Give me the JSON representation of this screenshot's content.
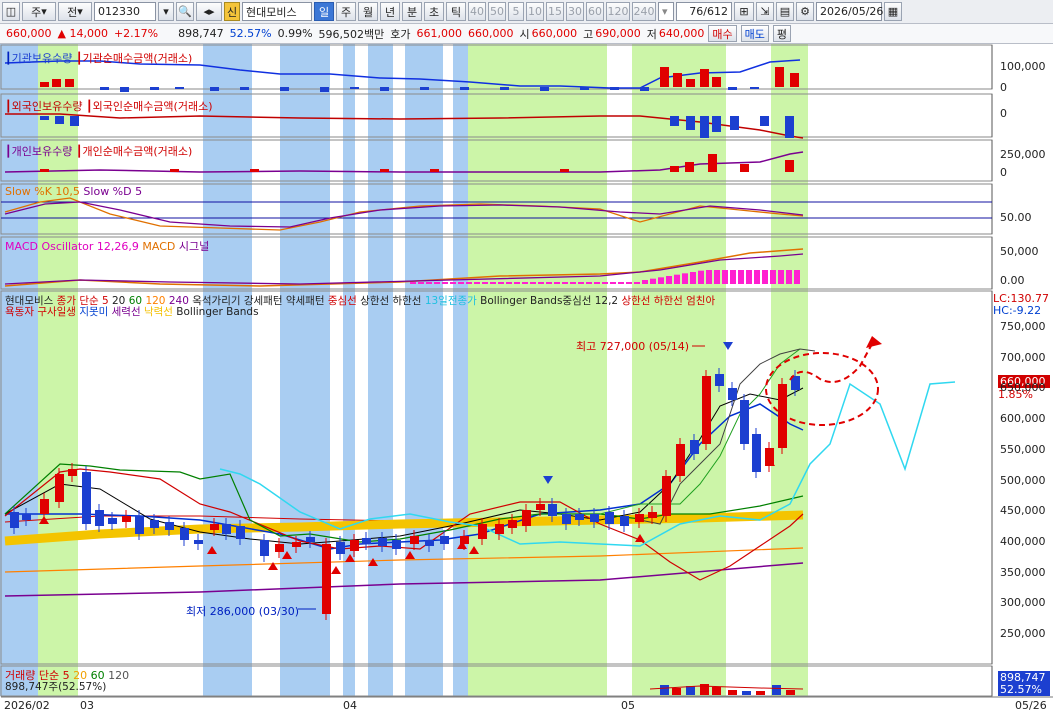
{
  "toolbar": {
    "type_select": "주",
    "period_select": "전",
    "code": "012330",
    "name_badge": "신",
    "stock_name": "현대모비스",
    "periods": [
      "일",
      "주",
      "월",
      "년",
      "분",
      "초",
      "틱"
    ],
    "active_period": "일",
    "minute_buttons": [
      "40",
      "50",
      "5",
      "10",
      "15",
      "30",
      "60",
      "120",
      "240"
    ],
    "counter": "76/612",
    "date": "2026/05/26"
  },
  "quote": {
    "price": "660,000",
    "change": "▲ 14,000",
    "change_pct": "+2.17%",
    "volume": "898,747",
    "vol_ratio": "52.57%",
    "turnover_pct": "0.99%",
    "amount": "596,502백만",
    "bid_label": "호가",
    "bid1": "661,000",
    "bid2": "660,000",
    "open_label": "시",
    "open": "660,000",
    "high_label": "고",
    "high": "690,000",
    "low_label": "저",
    "low": "640,000",
    "buy_btn": "매수",
    "sell_btn": "매도",
    "eval_btn": "평"
  },
  "panels": {
    "inst": {
      "l1": "기관보유수량",
      "l2": "기관순매수금액(거래소)",
      "ticks": [
        "100,000",
        "0"
      ]
    },
    "foreign": {
      "l1": "외국인보유수량",
      "l2": "외국인순매수금액(거래소)",
      "ticks": [
        "0"
      ]
    },
    "indiv": {
      "l1": "개인보유수량",
      "l2": "개인순매수금액(거래소)",
      "ticks": [
        "250,000",
        "0"
      ]
    },
    "stoch": {
      "l1": "Slow %K 10,5",
      "l2": "Slow %D 5",
      "ticks": [
        "50.00"
      ]
    },
    "macd": {
      "l1": "MACD Oscillator 12,26,9",
      "l2": "MACD",
      "l3": "시그널",
      "ticks": [
        "50,000",
        "0.00"
      ]
    },
    "price": {
      "legend1": [
        "현대모비스",
        "종가 단순 5",
        "20",
        "60",
        "120",
        "240",
        "옥석가리기 강세패턴",
        "약세패턴",
        "중심선",
        "상한선",
        "하한선",
        "13일전종가",
        "Bollinger Bands중심선 12,2",
        "상한선",
        "하한선",
        "엄친아"
      ],
      "legend2": [
        "욕동자",
        "구사일생",
        "지못미",
        "세력선",
        "낙력선",
        "Bollinger Bands"
      ],
      "lc": "LC:130.77",
      "hc": "HC:-9.22",
      "ticks": [
        "750,000",
        "700,000",
        "650,000",
        "600,000",
        "550,000",
        "500,000",
        "450,000",
        "400,000",
        "350,000",
        "300,000",
        "250,000"
      ],
      "price_tag": "660,000",
      "pct_tag": "1.85%",
      "max_label": "최고 727,000 (05/14)",
      "min_label": "최저 286,000 (03/30)"
    },
    "volume": {
      "l1": "거래량",
      "l2": "단순 5",
      "l3": "20",
      "l4": "60",
      "l5": "120",
      "value": "898,747주(52.57%)",
      "tag1": "898,747",
      "tag2": "52.57%"
    }
  },
  "xaxis": [
    "2026/02",
    "03",
    "04",
    "05",
    "05/26"
  ]
}
